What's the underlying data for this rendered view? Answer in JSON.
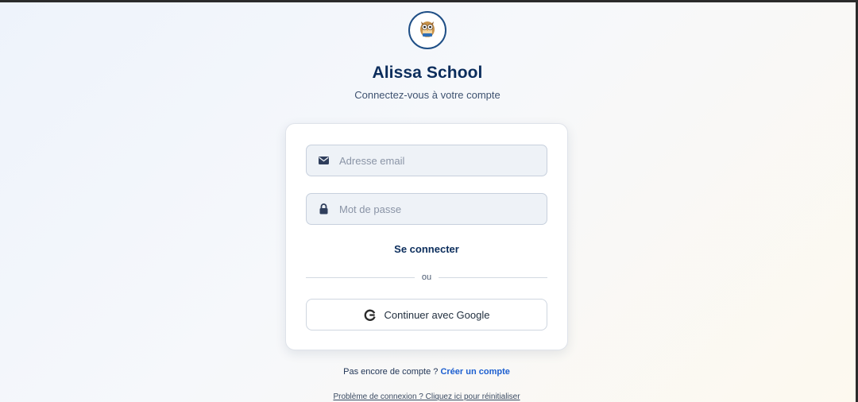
{
  "brand": {
    "title": "Alissa School",
    "subtitle": "Connectez-vous à votre compte",
    "logo_text": "Alissa School",
    "logo_icon": "owl-mascot-icon"
  },
  "form": {
    "email": {
      "placeholder": "Adresse email",
      "value": "",
      "icon": "envelope-icon"
    },
    "password": {
      "placeholder": "Mot de passe",
      "value": "",
      "icon": "lock-icon"
    },
    "login_label": "Se connecter",
    "divider_text": "ou",
    "google": {
      "label": "Continuer avec Google",
      "icon": "google-g-icon"
    }
  },
  "footer": {
    "signup_prompt": "Pas encore de compte ?",
    "signup_link": "Créer un compte",
    "reset_link": "Problème de connexion ? Cliquez ici pour réinitialiser"
  },
  "colors": {
    "primary": "#0b2d5c",
    "link": "#1d5fd0",
    "field_bg": "#eef2f7"
  }
}
